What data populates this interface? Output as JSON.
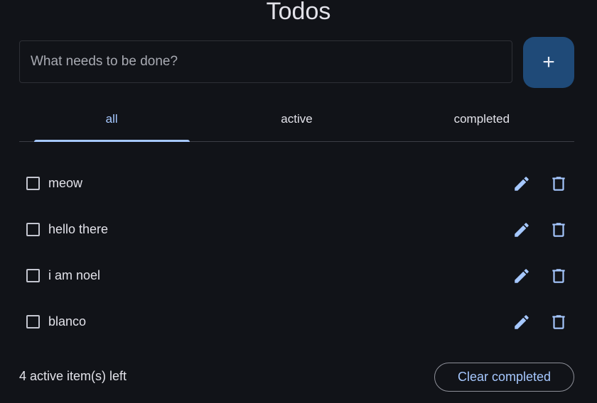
{
  "app": {
    "title": "Todos"
  },
  "new_todo": {
    "placeholder": "What needs to be done?",
    "value": "",
    "add_button_label": "+"
  },
  "tabs": [
    {
      "label": "all",
      "selected": true
    },
    {
      "label": "active",
      "selected": false
    },
    {
      "label": "completed",
      "selected": false
    }
  ],
  "todos": [
    {
      "label": "meow",
      "completed": false,
      "edit_icon": "pencil-icon",
      "delete_icon": "trash-icon"
    },
    {
      "label": "hello there",
      "completed": false,
      "edit_icon": "pencil-icon",
      "delete_icon": "trash-icon"
    },
    {
      "label": "i am noel",
      "completed": false,
      "edit_icon": "pencil-icon",
      "delete_icon": "trash-icon"
    },
    {
      "label": "blanco",
      "completed": false,
      "edit_icon": "pencil-icon",
      "delete_icon": "trash-icon"
    }
  ],
  "footer": {
    "count_text": "4 active item(s) left",
    "clear_label": "Clear completed"
  },
  "colors": {
    "background": "#111318",
    "accent": "#a6c8ff",
    "add_button": "#1f4a78",
    "text": "#e2e2e9"
  }
}
